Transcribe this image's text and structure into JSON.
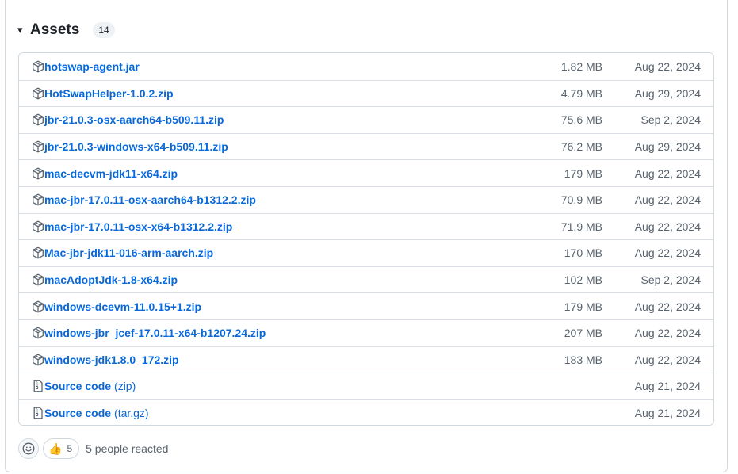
{
  "assets": {
    "title": "Assets",
    "count": "14",
    "caret": "▾",
    "items": [
      {
        "name": "hotswap-agent.jar",
        "size": "1.82 MB",
        "date": "Aug 22, 2024"
      },
      {
        "name": "HotSwapHelper-1.0.2.zip",
        "size": "4.79 MB",
        "date": "Aug 29, 2024"
      },
      {
        "name": "jbr-21.0.3-osx-aarch64-b509.11.zip",
        "size": "75.6 MB",
        "date": "Sep 2, 2024"
      },
      {
        "name": "jbr-21.0.3-windows-x64-b509.11.zip",
        "size": "76.2 MB",
        "date": "Aug 29, 2024"
      },
      {
        "name": "mac-decvm-jdk11-x64.zip",
        "size": "179 MB",
        "date": "Aug 22, 2024"
      },
      {
        "name": "mac-jbr-17.0.11-osx-aarch64-b1312.2.zip",
        "size": "70.9 MB",
        "date": "Aug 22, 2024"
      },
      {
        "name": "mac-jbr-17.0.11-osx-x64-b1312.2.zip",
        "size": "71.9 MB",
        "date": "Aug 22, 2024"
      },
      {
        "name": "Mac-jbr-jdk11-016-arm-aarch.zip",
        "size": "170 MB",
        "date": "Aug 22, 2024"
      },
      {
        "name": "macAdoptJdk-1.8-x64.zip",
        "size": "102 MB",
        "date": "Sep 2, 2024"
      },
      {
        "name": "windows-dcevm-11.0.15+1.zip",
        "size": "179 MB",
        "date": "Aug 22, 2024"
      },
      {
        "name": "windows-jbr_jcef-17.0.11-x64-b1207.24.zip",
        "size": "207 MB",
        "date": "Aug 22, 2024"
      },
      {
        "name": "windows-jdk1.8.0_172.zip",
        "size": "183 MB",
        "date": "Aug 22, 2024"
      }
    ],
    "source_items": [
      {
        "name": "Source code",
        "suffix": "(zip)",
        "date": "Aug 21, 2024"
      },
      {
        "name": "Source code",
        "suffix": "(tar.gz)",
        "date": "Aug 21, 2024"
      }
    ]
  },
  "reactions": {
    "emoji": "👍",
    "count": "5",
    "summary": "5 people reacted"
  },
  "colors": {
    "link": "#0969da",
    "muted": "#59636e",
    "border": "#d1d9e0"
  }
}
